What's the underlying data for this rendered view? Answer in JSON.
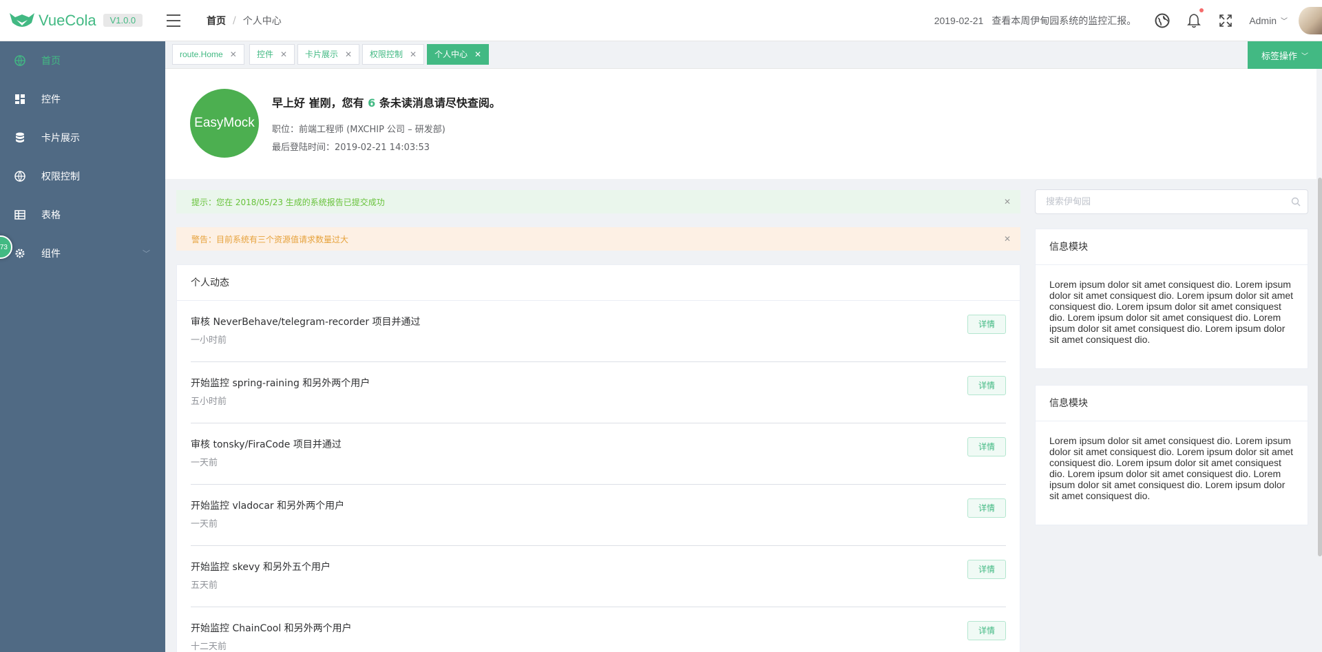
{
  "app": {
    "name": "VueCola",
    "version": "V1.0.0"
  },
  "colors": {
    "accent": "#42b983",
    "sidebar": "#506a84"
  },
  "header": {
    "breadcrumb": [
      "首页",
      "个人中心"
    ],
    "date": "2019-02-21",
    "notice": "查看本周伊甸园系统的监控汇报。",
    "user": "Admin",
    "icons": [
      "menu-toggle-icon",
      "globe-icon",
      "bell-icon",
      "fullscreen-icon"
    ]
  },
  "sidebar": {
    "items": [
      {
        "label": "首页",
        "icon": "globe-icon",
        "active": true
      },
      {
        "label": "控件",
        "icon": "dashboard-icon"
      },
      {
        "label": "卡片展示",
        "icon": "database-icon"
      },
      {
        "label": "权限控制",
        "icon": "globe-icon"
      },
      {
        "label": "表格",
        "icon": "table-icon"
      },
      {
        "label": "组件",
        "icon": "gear-icon",
        "expandable": true
      }
    ],
    "badge": "73"
  },
  "tabs": {
    "items": [
      {
        "label": "route.Home"
      },
      {
        "label": "控件"
      },
      {
        "label": "卡片展示"
      },
      {
        "label": "权限控制"
      },
      {
        "label": "个人中心",
        "active": true
      }
    ],
    "close": "✕",
    "ops_label": "标签操作"
  },
  "profile": {
    "avatar_text": "EasyMock",
    "greet_prefix": "早上好 崔刚，您有",
    "unread": "6",
    "greet_suffix": "条未读消息请尽快查阅。",
    "position": "职位：前端工程师 (MXCHIP 公司 – 研发部)",
    "last_login": "最后登陆时间：2019-02-21 14:03:53"
  },
  "alerts": {
    "success": "提示：您在 2018/05/23 生成的系统报告已提交成功",
    "warning": "警告：目前系统有三个资源值请求数量过大",
    "close": "✕"
  },
  "activity": {
    "title": "个人动态",
    "button": "详情",
    "items": [
      {
        "text": "审核 NeverBehave/telegram-recorder 项目并通过",
        "time": "一小时前"
      },
      {
        "text": "开始监控 spring-raining 和另外两个用户",
        "time": "五小时前"
      },
      {
        "text": "审核 tonsky/FiraCode 项目并通过",
        "time": "一天前"
      },
      {
        "text": "开始监控 vladocar 和另外两个用户",
        "time": "一天前"
      },
      {
        "text": "开始监控 skevy 和另外五个用户",
        "time": "五天前"
      },
      {
        "text": "开始监控 ChainCool 和另外两个用户",
        "time": "十二天前"
      }
    ]
  },
  "search": {
    "placeholder": "搜索伊甸园"
  },
  "info": [
    {
      "title": "信息模块",
      "body": "Lorem ipsum dolor sit amet consiquest dio. Lorem ipsum dolor sit amet consiquest dio. Lorem ipsum dolor sit amet consiquest dio. Lorem ipsum dolor sit amet consiquest dio. Lorem ipsum dolor sit amet consiquest dio. Lorem ipsum dolor sit amet consiquest dio. Lorem ipsum dolor sit amet consiquest dio."
    },
    {
      "title": "信息模块",
      "body": "Lorem ipsum dolor sit amet consiquest dio. Lorem ipsum dolor sit amet consiquest dio. Lorem ipsum dolor sit amet consiquest dio. Lorem ipsum dolor sit amet consiquest dio. Lorem ipsum dolor sit amet consiquest dio. Lorem ipsum dolor sit amet consiquest dio. Lorem ipsum dolor sit amet consiquest dio."
    }
  ]
}
